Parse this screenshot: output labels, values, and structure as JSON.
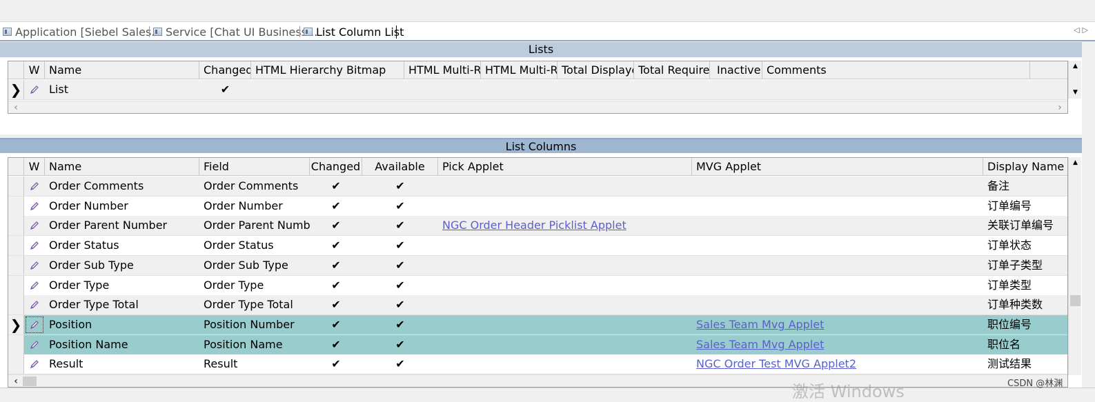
{
  "tabs": [
    {
      "label": "Application [Siebel Sales..."
    },
    {
      "label": "Service [Chat UI Business..."
    },
    {
      "label": "List Column List"
    }
  ],
  "lists": {
    "title": "Lists",
    "columns": [
      "W",
      "Name",
      "Changed",
      "HTML Hierarchy Bitmap",
      "HTML Multi-R",
      "HTML Multi-R",
      "Total Displaye",
      "Total Require",
      "Inactive",
      "Comments"
    ],
    "rows": [
      {
        "name": "List",
        "changed": "✔"
      }
    ]
  },
  "list_columns": {
    "title": "List Columns",
    "columns": [
      "W",
      "Name",
      "Field",
      "Changed",
      "Available",
      "Pick Applet",
      "MVG Applet",
      "Display Name -"
    ],
    "rows": [
      {
        "name": "Order Comments",
        "field": "Order Comments",
        "changed": "✔",
        "available": "✔",
        "pick_applet": "",
        "mvg_applet": "",
        "display_name": "备注"
      },
      {
        "name": "Order Number",
        "field": "Order Number",
        "changed": "✔",
        "available": "✔",
        "pick_applet": "",
        "mvg_applet": "",
        "display_name": "订单编号"
      },
      {
        "name": "Order Parent Number",
        "field": "Order Parent Numbe",
        "changed": "✔",
        "available": "✔",
        "pick_applet": "NGC Order Header Picklist Applet",
        "mvg_applet": "",
        "display_name": "关联订单编号"
      },
      {
        "name": "Order Status",
        "field": "Order Status",
        "changed": "✔",
        "available": "✔",
        "pick_applet": "",
        "mvg_applet": "",
        "display_name": "订单状态"
      },
      {
        "name": "Order Sub Type",
        "field": "Order Sub Type",
        "changed": "✔",
        "available": "✔",
        "pick_applet": "",
        "mvg_applet": "",
        "display_name": "订单子类型"
      },
      {
        "name": "Order Type",
        "field": "Order Type",
        "changed": "✔",
        "available": "✔",
        "pick_applet": "",
        "mvg_applet": "",
        "display_name": "订单类型"
      },
      {
        "name": "Order Type Total",
        "field": "Order Type Total",
        "changed": "✔",
        "available": "✔",
        "pick_applet": "",
        "mvg_applet": "",
        "display_name": "订单种类数"
      },
      {
        "name": "Position",
        "field": "Position Number",
        "changed": "✔",
        "available": "✔",
        "pick_applet": "",
        "mvg_applet": "Sales Team Mvg Applet",
        "display_name": "职位编号"
      },
      {
        "name": "Position Name",
        "field": "Position Name",
        "changed": "✔",
        "available": "✔",
        "pick_applet": "",
        "mvg_applet": "Sales Team Mvg Applet",
        "display_name": "职位名"
      },
      {
        "name": "Result",
        "field": "Result",
        "changed": "✔",
        "available": "✔",
        "pick_applet": "",
        "mvg_applet": "NGC Order Test MVG Applet2",
        "display_name": "测试结果"
      }
    ]
  },
  "overlay": {
    "watermark": "激活 Windows",
    "credit": "CSDN @林渊"
  },
  "colors": {
    "section_header": "#bccbde",
    "selected_row": "#99cccc",
    "alt_row": "#f0f0f0",
    "link": "#5a5fcf"
  }
}
